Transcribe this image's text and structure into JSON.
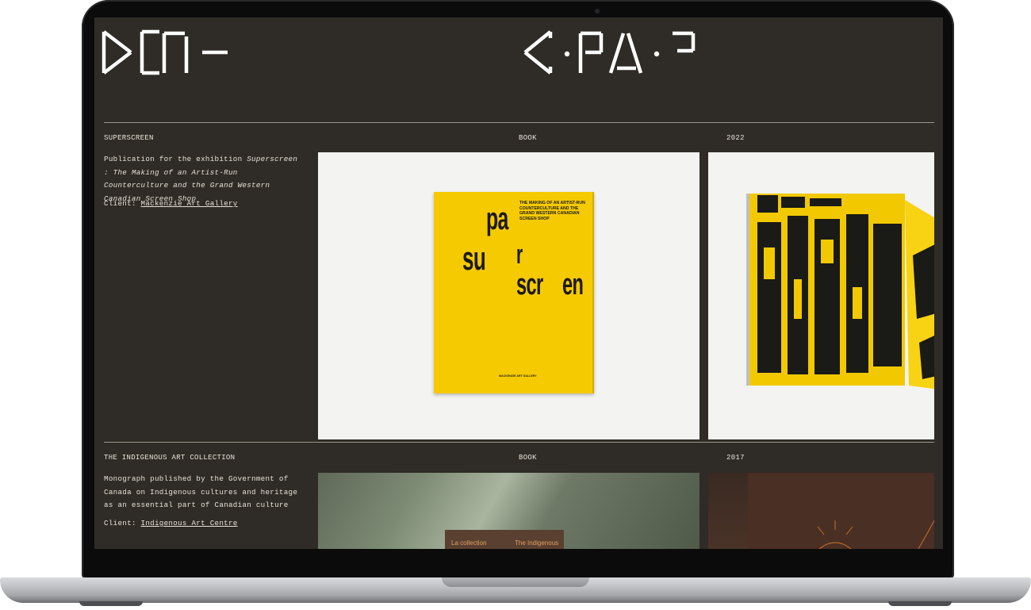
{
  "projects": [
    {
      "title": "SUPERSCREEN",
      "category": "BOOK",
      "year": "2022",
      "desc_prefix": "Publication for the exhibition ",
      "desc_italic": "Superscreen : The Making of an Artist-Run Counterculture and the Grand Western Canadian Screen Shop",
      "client_label": "Client: ",
      "client_name": "Mackenzie Art Gallery",
      "cover_subtitle": "THE MAKING OF AN ARTIST-RUN COUNTERCULTURE AND THE GRAND WESTERN CANADIAN SCREEN SHOP",
      "cover_words": [
        "su",
        "pa",
        "r",
        "scr",
        "en"
      ],
      "cover_publisher": "MACKENZIE ART GALLERY"
    },
    {
      "title": "THE INDIGENOUS ART COLLECTION",
      "category": "BOOK",
      "year": "2017",
      "desc": "Monograph published by the Government of Canada on Indigenous cultures and heritage as an essential part of Canadian culture",
      "client_label": "Client: ",
      "client_name": "Indigenous Art Centre",
      "book_text_left": "La collection",
      "book_text_right": "The Indigenous"
    }
  ],
  "colors": {
    "screen_bg": "#2f2b26",
    "text": "#e7e2d8",
    "cover_yellow": "#f6ca00"
  }
}
